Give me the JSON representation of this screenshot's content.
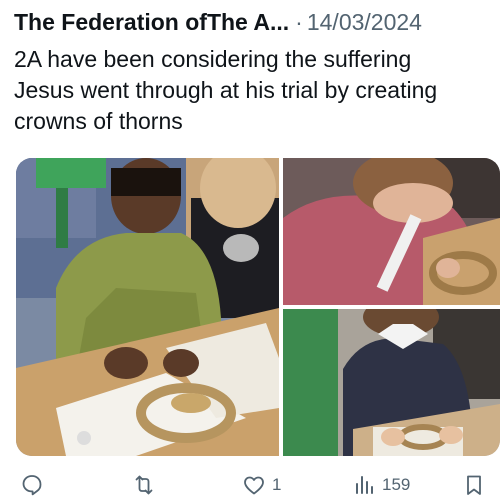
{
  "tweet": {
    "author": "The Federation ofThe A...",
    "separator": "·",
    "date": "14/03/2024",
    "text": "2A have been considering the suffering\nJesus went through at his trial by creating\ncrowns of thorns"
  },
  "media": {
    "photos": [
      {
        "name": "children-making-crowns-photo"
      },
      {
        "name": "boy-making-crown-photo"
      },
      {
        "name": "girl-making-crown-photo"
      }
    ]
  },
  "actions": {
    "reply": {
      "icon": "reply-icon",
      "count": ""
    },
    "retweet": {
      "icon": "retweet-icon",
      "count": ""
    },
    "like": {
      "icon": "heart-icon",
      "count": "1"
    },
    "views": {
      "icon": "views-chart-icon",
      "count": "159"
    },
    "bookmark": {
      "icon": "bookmark-icon",
      "count": ""
    }
  },
  "colors": {
    "text": "#0f1419",
    "muted": "#536471"
  }
}
